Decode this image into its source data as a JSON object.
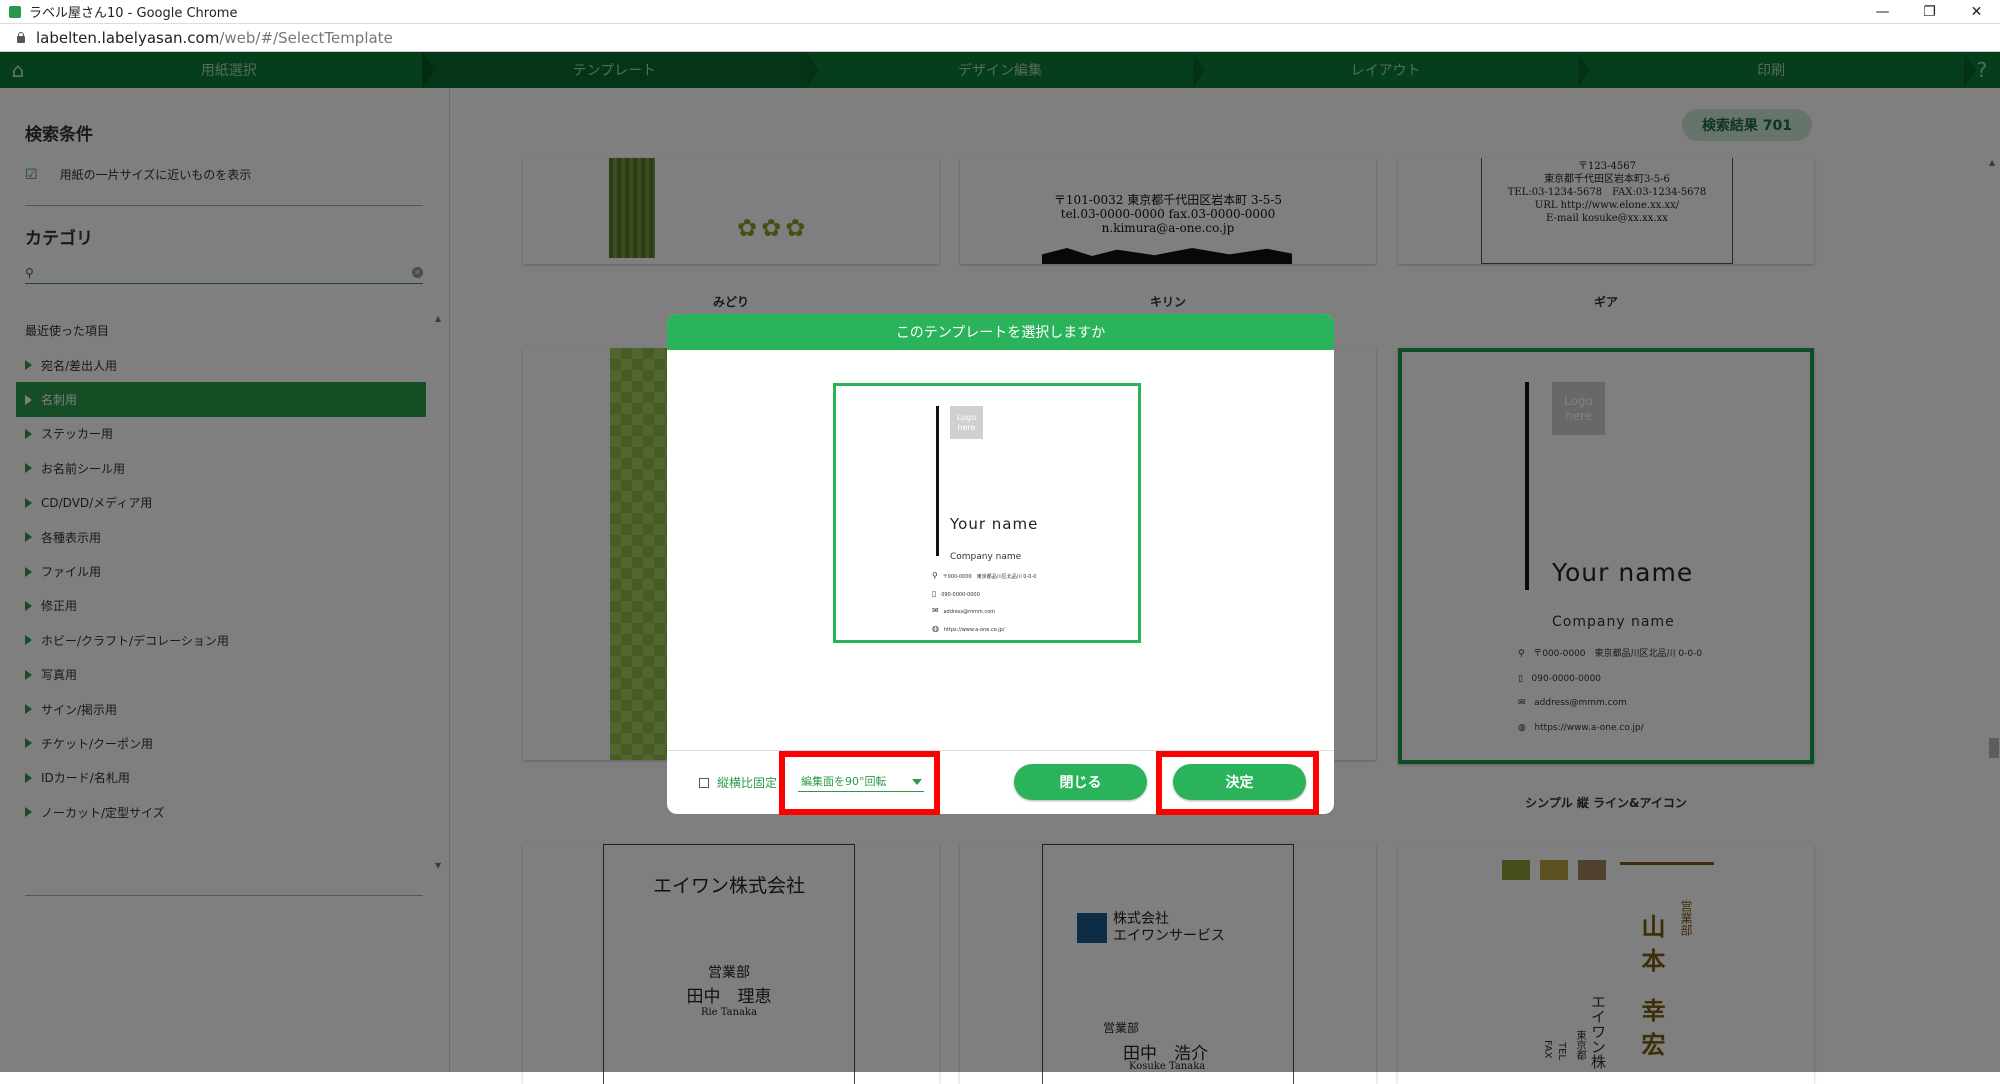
{
  "window": {
    "title": "ラベル屋さん10 - Google Chrome",
    "controls": [
      "—",
      "❐",
      "✕"
    ]
  },
  "browser": {
    "url_host": "labelten.labelyasan.com",
    "url_path": "/web/#/SelectTemplate"
  },
  "steps": [
    {
      "label": "用紙選択"
    },
    {
      "label": "テンプレート"
    },
    {
      "label": "デザイン編集"
    },
    {
      "label": "レイアウト"
    },
    {
      "label": "印刷"
    }
  ],
  "nav_icons": {
    "home": "⌂",
    "help": "?"
  },
  "sidebar": {
    "search_title": "検索条件",
    "check_label": "用紙の一片サイズに近いものを表示",
    "check_glyph": "☑",
    "category_title": "カテゴリ",
    "search_icon": "⚲",
    "clear_icon": "✕",
    "recent": "最近使った項目",
    "categories": [
      "宛名/差出人用",
      "名刺用",
      "ステッカー用",
      "お名前シール用",
      "CD/DVD/メディア用",
      "各種表示用",
      "ファイル用",
      "修正用",
      "ホビー/クラフト/デコレーション用",
      "写真用",
      "サイン/掲示用",
      "チケット/クーポン用",
      "IDカード/名札用",
      "ノーカット/定型サイズ"
    ],
    "selected_index": 1,
    "scroll_up": "▲",
    "scroll_down": "▼"
  },
  "main": {
    "result_badge": "検索結果 701",
    "labels": {
      "midori": "みどり",
      "kirin": "キリン",
      "gear": "ギア",
      "simple": "シンプル 縦 ライン&アイコン"
    },
    "kirin_card": {
      "line1": "〒101-0032 東京都千代田区岩本町 3-5-5",
      "line2": "tel.03-0000-0000 fax.03-0000-0000",
      "line3": "n.kimura@a-one.co.jp"
    },
    "gear_card": {
      "line1": "〒123-4567",
      "line2": "東京都千代田区岩本町3-5-6",
      "line3": "TEL:03-1234-5678　FAX:03-1234-5678",
      "line4": "URL http://www.elone.xx.xx/",
      "line5": "E-mail kosuke@xx.xx.xx"
    },
    "simple_card": {
      "logo": "Logo here",
      "name": "Your name",
      "company": "Company name",
      "addr": "〒000-0000　東京都品川区北品川 0-0-0",
      "phone": "090-0000-0000",
      "mail": "address@mmm.com",
      "web": "https://www.a-one.co.jp/"
    },
    "aone_card": {
      "company": "エイワン株式会社",
      "dept": "営業部",
      "name": "田中　理恵",
      "roman": "Rie  Tanaka"
    },
    "service_card": {
      "company1": "株式会社",
      "company2": "エイワンサービス",
      "dept": "営業部",
      "name": "田中　浩介",
      "roman": "Kosuke  Tanaka"
    },
    "vertical_card": {
      "dept": "営業部",
      "surname": "山本",
      "given": "幸宏",
      "company": "エイワン株",
      "addr": "東京都",
      "tel": "TEL",
      "fax": "FAX"
    }
  },
  "modal": {
    "title": "このテンプレートを選択しますか",
    "preview": {
      "logo": "Logo here",
      "name": "Your name",
      "company": "Company name",
      "addr": "〒000-0000　東京都品川区北品川 0-0-0",
      "phone": "090-0000-0000",
      "mail": "address@mmm.com",
      "web": "https://www.a-one.co.jp/"
    },
    "aspect_label": "縦横比固定",
    "rotate_value": "編集面を90°回転",
    "close_label": "閉じる",
    "ok_label": "決定"
  },
  "colors": {
    "brand": "#2ab35a",
    "nav": "#0c7a36",
    "highlight": "#ff0000"
  }
}
